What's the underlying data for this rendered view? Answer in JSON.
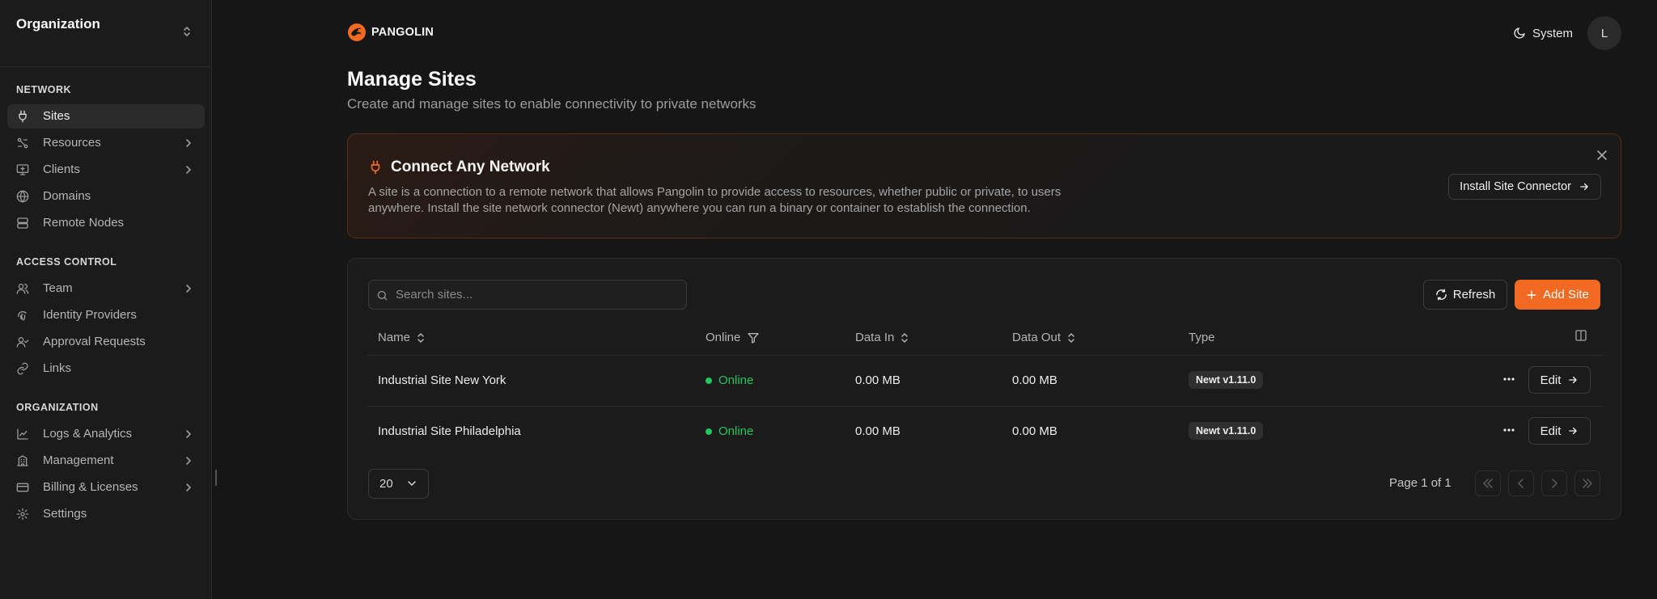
{
  "sidebar": {
    "org_title": "Organization",
    "sections": {
      "network": "NETWORK",
      "access": "ACCESS CONTROL",
      "organization": "ORGANIZATION"
    },
    "items": {
      "sites": "Sites",
      "resources": "Resources",
      "clients": "Clients",
      "domains": "Domains",
      "remote_nodes": "Remote Nodes",
      "team": "Team",
      "identity_providers": "Identity Providers",
      "approval_requests": "Approval Requests",
      "links": "Links",
      "logs": "Logs & Analytics",
      "management": "Management",
      "billing": "Billing & Licenses",
      "settings": "Settings"
    }
  },
  "header": {
    "brand": "PANGOLIN",
    "theme_label": "System",
    "avatar_initial": "L"
  },
  "page": {
    "title": "Manage Sites",
    "subtitle": "Create and manage sites to enable connectivity to private networks"
  },
  "banner": {
    "title": "Connect Any Network",
    "text": "A site is a connection to a remote network that allows Pangolin to provide access to resources, whether public or private, to users anywhere. Install the site network connector (Newt) anywhere you can run a binary or container to establish the connection.",
    "button": "Install Site Connector"
  },
  "table": {
    "search_placeholder": "Search sites...",
    "refresh_label": "Refresh",
    "add_label": "Add Site",
    "columns": {
      "name": "Name",
      "online": "Online",
      "data_in": "Data In",
      "data_out": "Data Out",
      "type": "Type"
    },
    "rows": [
      {
        "name": "Industrial Site New York",
        "status": "Online",
        "data_in": "0.00 MB",
        "data_out": "0.00 MB",
        "type": "Newt v1.11.0",
        "edit": "Edit"
      },
      {
        "name": "Industrial Site Philadelphia",
        "status": "Online",
        "data_in": "0.00 MB",
        "data_out": "0.00 MB",
        "type": "Newt v1.11.0",
        "edit": "Edit"
      }
    ],
    "page_size": "20",
    "page_info": "Page 1 of 1"
  },
  "colors": {
    "accent": "#f26a21",
    "online": "#22c55e",
    "background": "#161616",
    "sidebar": "#1b1b1b"
  }
}
